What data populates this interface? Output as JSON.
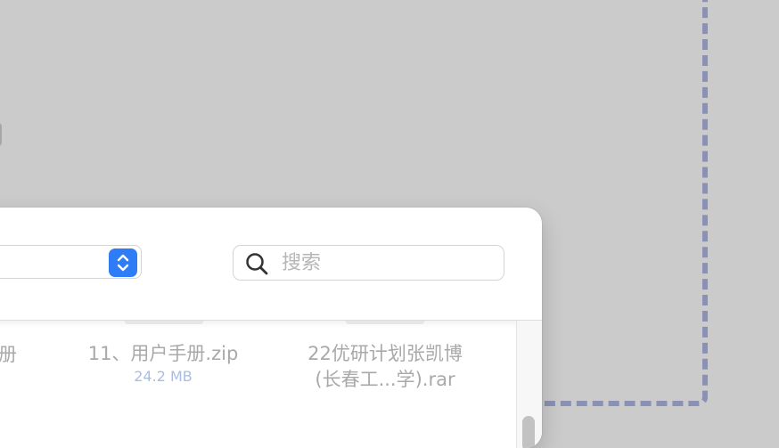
{
  "search": {
    "placeholder": "搜索",
    "value": ""
  },
  "location_select": {
    "selected_value": ""
  },
  "files": {
    "partial_left_label": "册",
    "items": [
      {
        "name": "11、用户手册.zip",
        "size": "24.2 MB"
      },
      {
        "name_line1": "22优研计划张凯博",
        "name_line2": "(长春工...学).rar"
      }
    ]
  },
  "icons": {
    "search": "search-icon",
    "stepper": "up-down-chevron-icon"
  },
  "colors": {
    "accent": "#2f7df6",
    "size_text": "#a9bde3",
    "file_text": "#a9a9a9",
    "drop_outline": "#8b91b4"
  }
}
